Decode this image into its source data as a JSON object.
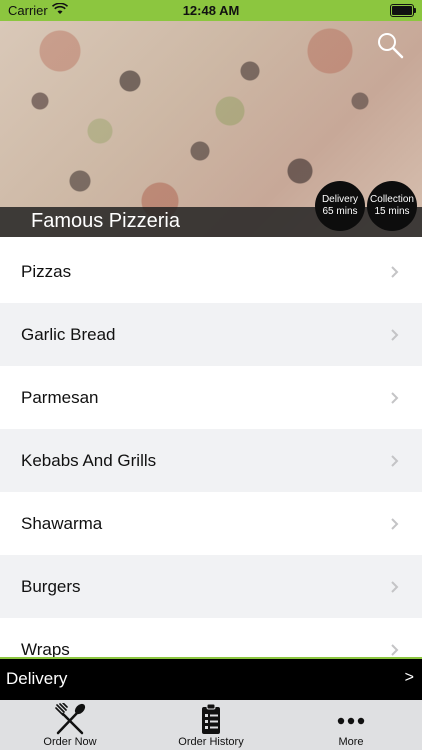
{
  "status_bar": {
    "carrier": "Carrier",
    "time": "12:48 AM"
  },
  "header": {
    "title": "Famous Pizzeria",
    "delivery_badge": {
      "label": "Delivery",
      "time": "65 mins"
    },
    "collection_badge": {
      "label": "Collection",
      "time": "15 mins"
    }
  },
  "menu": {
    "items": [
      {
        "label": "Pizzas"
      },
      {
        "label": "Garlic Bread"
      },
      {
        "label": "Parmesan"
      },
      {
        "label": "Kebabs And Grills"
      },
      {
        "label": "Shawarma"
      },
      {
        "label": "Burgers"
      },
      {
        "label": "Wraps"
      }
    ]
  },
  "delivery_bar": {
    "label": "Delivery",
    "arrow": ">"
  },
  "tab_bar": {
    "tabs": [
      {
        "label": "Order Now",
        "icon": "utensils-icon"
      },
      {
        "label": "Order History",
        "icon": "clipboard-icon"
      },
      {
        "label": "More",
        "icon": "more-dots-icon"
      }
    ]
  },
  "colors": {
    "accent": "#8cc63f",
    "badge": "#0d0d0d",
    "tab_bar": "#dfe0e2"
  }
}
